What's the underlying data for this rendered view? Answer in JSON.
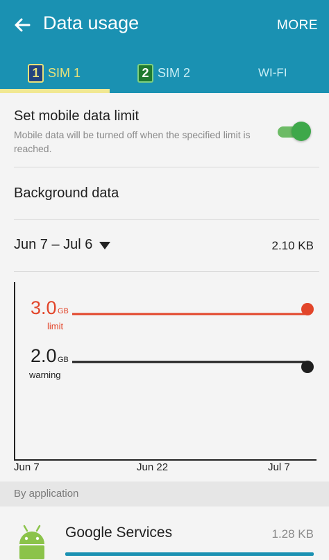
{
  "header": {
    "title": "Data usage",
    "more_label": "MORE",
    "back_icon": "arrow-left-icon",
    "background_color": "#1a91b2"
  },
  "tabs": [
    {
      "badge": "1",
      "label": "SIM 1",
      "selected": true
    },
    {
      "badge": "2",
      "label": "SIM 2",
      "selected": false
    },
    {
      "label": "WI-FI",
      "selected": false
    }
  ],
  "settings": {
    "mobile_data_limit": {
      "title": "Set mobile data limit",
      "description": "Mobile data will be turned off when the specified limit is reached.",
      "enabled": true
    },
    "background_data": {
      "title": "Background data"
    },
    "cycle": {
      "label": "Jun 7 – Jul 6",
      "total": "2.10 KB"
    }
  },
  "chart": {
    "limit": {
      "value": "3.0",
      "unit": "GB",
      "label": "limit",
      "color": "#e2452a"
    },
    "warning": {
      "value": "2.0",
      "unit": "GB",
      "label": "warning",
      "color": "#1f1f1f"
    },
    "x_ticks": [
      "Jun 7",
      "Jun 22",
      "Jul 7"
    ]
  },
  "by_application": {
    "title": "By application",
    "apps": [
      {
        "name": "Google Services",
        "usage": "1.28 KB",
        "icon": "android-icon"
      }
    ]
  }
}
